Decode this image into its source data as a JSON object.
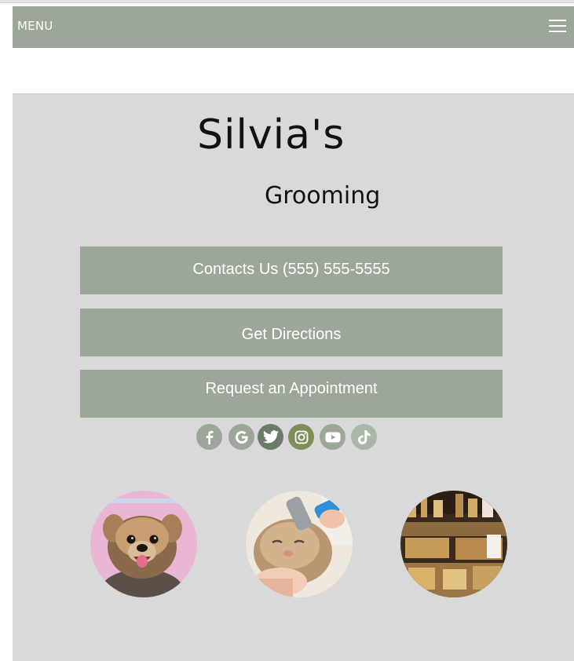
{
  "menu": {
    "label": "MENU"
  },
  "hero": {
    "title": "Silvia's",
    "subtitle": "Grooming"
  },
  "buttons": {
    "contact": "Contacts Us  (555) 555-5555",
    "directions": "Get Directions",
    "appointment": "Request an Appointment"
  },
  "social": [
    {
      "icon": "facebook-icon",
      "color": "#9ca79a"
    },
    {
      "icon": "google-icon",
      "color": "#9ca79a"
    },
    {
      "icon": "twitter-icon",
      "color": "#6b7d68"
    },
    {
      "icon": "instagram-icon",
      "color": "#7e8e58"
    },
    {
      "icon": "youtube-icon",
      "color": "#9ca79a"
    },
    {
      "icon": "tiktok-icon",
      "color": "#aab6a8"
    }
  ],
  "photos": [
    {
      "icon": "yorkie-dog-photo"
    },
    {
      "icon": "cat-brushing-photo"
    },
    {
      "icon": "pet-store-shelves-photo"
    }
  ],
  "colors": {
    "accent": "#9ca79a",
    "panel": "#d9d9da"
  }
}
